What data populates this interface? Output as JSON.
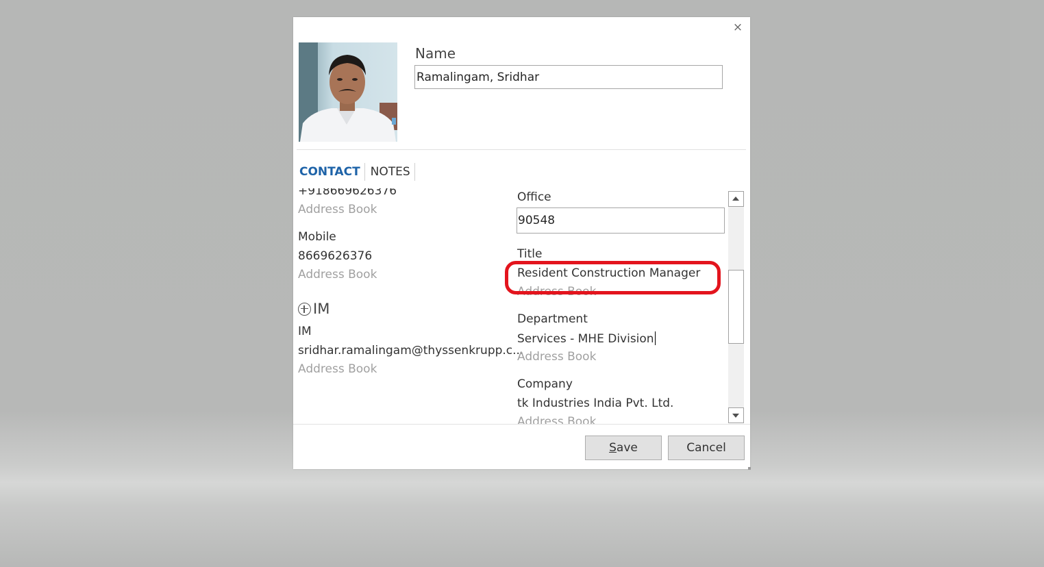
{
  "dialog": {
    "close_icon": "×",
    "name_label": "Name",
    "name_value": "Ramalingam, Sridhar"
  },
  "tabs": [
    {
      "label": "CONTACT",
      "active": true
    },
    {
      "label": "NOTES",
      "active": false
    }
  ],
  "left_column": {
    "phone_partial": "+918669626376",
    "phone_source": "Address Book",
    "mobile_label": "Mobile",
    "mobile_value": "8669626376",
    "mobile_source": "Address Book",
    "im_add_label": "IM",
    "im_label": "IM",
    "im_value": "sridhar.ramalingam@thyssenkrupp.c...",
    "im_source": "Address Book"
  },
  "right_column": {
    "office_label": "Office",
    "office_value": "90548",
    "title_label": "Title",
    "title_value": "Resident Construction Manager",
    "title_source": "Address Book",
    "department_label": "Department",
    "department_value": "Services - MHE Division",
    "department_source": "Address Book",
    "company_label": "Company",
    "company_value": "tk Industries India Pvt. Ltd.",
    "company_source": "Address Book"
  },
  "buttons": {
    "save_mnemonic": "S",
    "save_rest": "ave",
    "cancel_label": "Cancel"
  },
  "colors": {
    "highlight_ring": "#e3141d",
    "active_tab": "#1e63a8"
  }
}
